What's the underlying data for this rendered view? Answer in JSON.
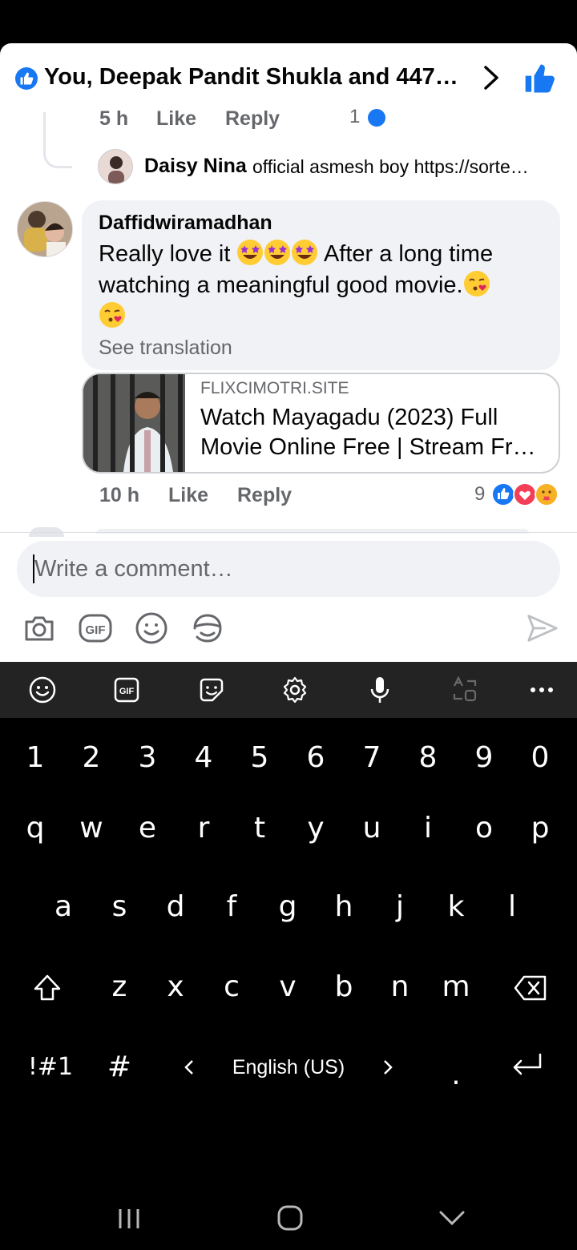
{
  "header": {
    "title": "You, Deepak Pandit Shukla and 447…"
  },
  "previous_comment": {
    "time": "5 h",
    "like_label": "Like",
    "reply_label": "Reply",
    "reaction_count": "1"
  },
  "reply_preview": {
    "name": "Daisy Nina",
    "text": "official asmesh boy  https://sorte…"
  },
  "comment": {
    "author": "Daffidwiramadhan",
    "text_part1": "Really love it",
    "text_part2": "After a long time watching a meaningful good movie.",
    "see_translation": "See translation",
    "link": {
      "domain": "FLIXCIMOTRI.SITE",
      "title": "Watch Mayagadu (2023) Full Movie Online Free | Stream Fr…"
    },
    "time": "10 h",
    "like_label": "Like",
    "reply_label": "Reply",
    "reaction_count": "9"
  },
  "composer": {
    "placeholder": "Write a comment…"
  },
  "keyboard": {
    "row_numbers": [
      "1",
      "2",
      "3",
      "4",
      "5",
      "6",
      "7",
      "8",
      "9",
      "0"
    ],
    "row_top": [
      "q",
      "w",
      "e",
      "r",
      "t",
      "y",
      "u",
      "i",
      "o",
      "p"
    ],
    "row_middle": [
      "a",
      "s",
      "d",
      "f",
      "g",
      "h",
      "j",
      "k",
      "l"
    ],
    "row_bottom": [
      "z",
      "x",
      "c",
      "v",
      "b",
      "n",
      "m"
    ],
    "symbols_key": "!#1",
    "hash_key": "#",
    "language": "English (US)",
    "period_key": ".",
    "gif_label": "GIF"
  },
  "colors": {
    "accent": "#1877f2",
    "text_primary": "#050505",
    "text_secondary": "#65676b",
    "bubble": "#f0f2f5",
    "keyboard_bg": "#000000",
    "keyboard_toolbar": "#232323"
  }
}
